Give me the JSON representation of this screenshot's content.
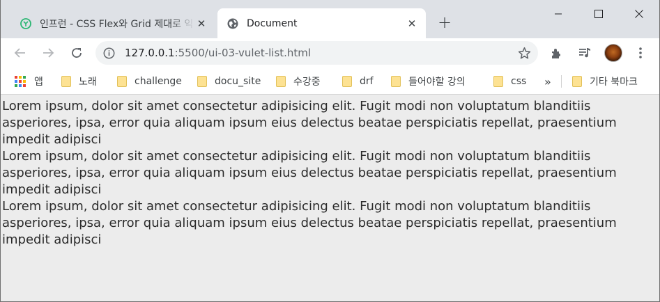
{
  "tabs": [
    {
      "title": "인프런 - CSS Flex와 Grid 제대로 익히기",
      "favicon": "inflearn-icon",
      "active": false
    },
    {
      "title": "Document",
      "favicon": "globe-icon",
      "active": true
    }
  ],
  "new_tab_label": "+",
  "close_glyph": "✕",
  "address_bar": {
    "url_host": "127.0.0.1",
    "url_rest": ":5500/ui-03-vulet-list.html"
  },
  "bookmarks": {
    "apps_label": "앱",
    "items": [
      "노래",
      "challenge",
      "docu_site",
      "수강중",
      "drf",
      "들어야할 강의",
      "css"
    ],
    "overflow": "»",
    "other_label": "기타 북마크"
  },
  "page": {
    "paragraphs": [
      "Lorem ipsum, dolor sit amet consectetur adipisicing elit. Fugit modi non voluptatum blanditiis asperiores, ipsa, error quia aliquam ipsum eius delectus beatae perspiciatis repellat, praesentium impedit adipisci",
      "Lorem ipsum, dolor sit amet consectetur adipisicing elit. Fugit modi non voluptatum blanditiis asperiores, ipsa, error quia aliquam ipsum eius delectus beatae perspiciatis repellat, praesentium impedit adipisci",
      "Lorem ipsum, dolor sit amet consectetur adipisicing elit. Fugit modi non voluptatum blanditiis asperiores, ipsa, error quia aliquam ipsum eius delectus beatae perspiciatis repellat, praesentium impedit adipisci"
    ]
  },
  "colors": {
    "tabstrip_bg": "#dee1e6",
    "page_bg": "#ececec",
    "folder": "#fde293",
    "inflearn_green": "#2bb673"
  }
}
